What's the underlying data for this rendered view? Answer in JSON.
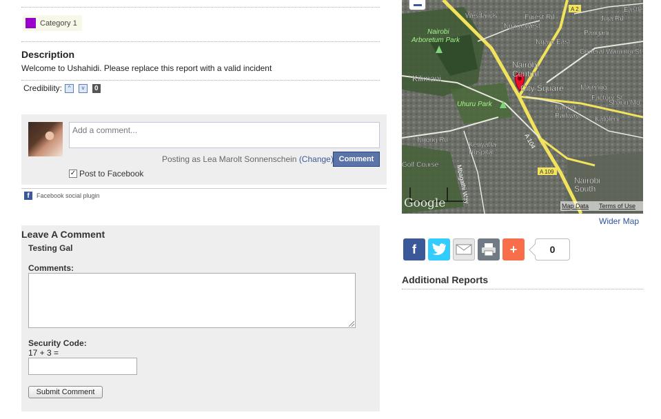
{
  "report": {
    "category_label": "Category 1",
    "category_color": "#9900cc",
    "description_title": "Description",
    "description_text": "Welcome to Ushahidi. Please replace this report with a valid incident",
    "credibility_label": "Credibility:",
    "vote_up_icon": "^",
    "vote_down_icon": "v",
    "credibility_count": "0"
  },
  "facebook": {
    "placeholder": "Add a comment...",
    "posting_as": "Posting as Lea Marolt Sonnenschein",
    "change_link": "(Change)",
    "comment_button": "Comment",
    "post_to_facebook": "Post to Facebook",
    "plugin_label": "Facebook social plugin",
    "plugin_icon": "f",
    "brand_color": "#3b5998"
  },
  "leave_comment": {
    "title": "Leave A Comment",
    "user": "Testing Gal",
    "comments_label": "Comments:",
    "security_label": "Security Code:",
    "security_question": "17 + 3 =",
    "submit_label": "Submit Comment"
  },
  "map": {
    "labels": {
      "westlands": "Westlands",
      "forest_rd": "Forest Rd",
      "a2": "A 2",
      "eastle": "Eastle",
      "ngara_west": "Ngara West",
      "juja_rd": "Juja Rd",
      "nairobi_arboretum": "Nairobi",
      "arboretum_park": "Arboretum Park",
      "ngara_east": "Ngara East",
      "pangani": "Pangani",
      "general_waruingi": "General Waruingi St",
      "kilimani": "Kilimani",
      "nairobi_central_1": "Nairobi",
      "nairobi_central_2": "Central",
      "city_square": "City Square",
      "majengo": "Majengo",
      "factory_st": "Factory St",
      "uhuru_park": "Uhuru Park",
      "nairobi_railway_1": "Nairobi",
      "nairobi_railway_2": "Railway",
      "shauri_mo": "Shauri Mo",
      "kaloleni": "Kaloleni",
      "ngong_rd": "Ngong Rd",
      "a104": "A 104",
      "kenyatta_1": "Kenyatta",
      "kenyatta_2": "Hospital",
      "golf_course": "Golf Course",
      "mbagathi": "Mbagathi Way",
      "a109": "A 109",
      "nairobi_south_1": "Nairobi",
      "nairobi_south_2": "South",
      "google": "Google",
      "map_data": "Map Data",
      "terms": "Terms of Use"
    },
    "marker_color": "#e8102a",
    "wider_map": "Wider Map"
  },
  "share": {
    "facebook_icon": "f",
    "twitter_icon": "bird",
    "email_icon": "envelope",
    "print_icon": "printer",
    "add_icon": "+",
    "count": "0"
  },
  "additional_reports": {
    "title": "Additional Reports"
  }
}
